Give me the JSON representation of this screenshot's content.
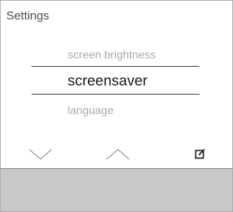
{
  "screen": {
    "title": "Settings"
  },
  "menu": {
    "previous_item": "screen brightness",
    "selected_item": "screensaver",
    "next_item": "language"
  },
  "softkeys": {
    "down_icon": "chevron-down-icon",
    "up_icon": "chevron-up-icon",
    "edit_icon": "edit-icon"
  },
  "colors": {
    "bottom_bar": "#c7c7c7",
    "selected_text": "#1a1a1a",
    "inactive_text": "#a9a9a9"
  }
}
